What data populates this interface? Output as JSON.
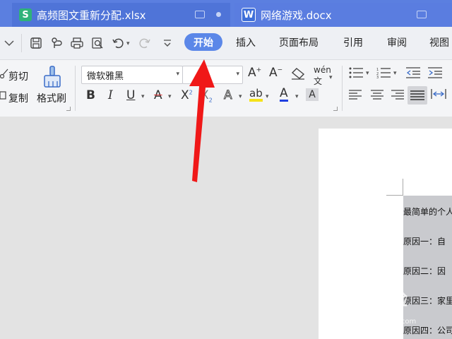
{
  "tabs": [
    {
      "logo": "S",
      "title": "高频图文重新分配.xlsx",
      "logo_color": "#2fb27a"
    },
    {
      "logo": "W",
      "title": "网络游戏.docx",
      "logo_color": "#3f6fd9"
    }
  ],
  "menu": {
    "items": [
      "开始",
      "插入",
      "页面布局",
      "引用",
      "审阅",
      "视图"
    ],
    "active": "开始"
  },
  "ribbon": {
    "cut_label": "剪切",
    "copy_label": "复制",
    "format_painter_label": "格式刷",
    "font_name": "微软雅黑",
    "font_size": "",
    "highlight_color": "#f5e21a",
    "font_color": "#e02020"
  },
  "document": {
    "lines": [
      "最简单的个人",
      "原因一：自",
      "原因二：因",
      "原因三：家里",
      "原因四：公司"
    ]
  },
  "watermark": {
    "brand": "Bai 经验",
    "url": "jingyan.baidu.com"
  },
  "colors": {
    "accent": "#5b87e8",
    "tabbar": "#5b7fe0",
    "arrow": "#f01818"
  }
}
